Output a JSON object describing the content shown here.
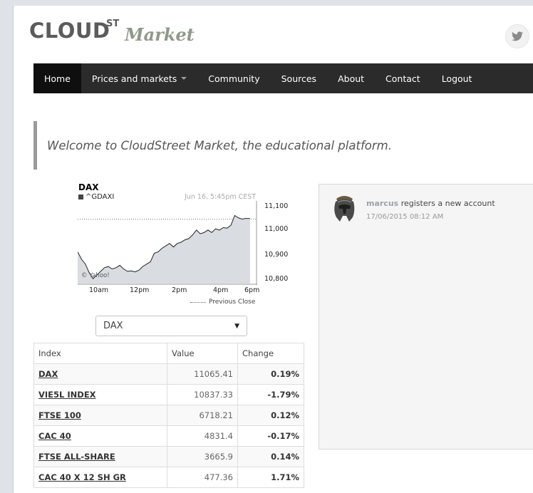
{
  "logo": {
    "cloud": "CLOUD",
    "st": "ST",
    "market": "Market"
  },
  "nav": {
    "items": [
      {
        "label": "Home",
        "active": true
      },
      {
        "label": "Prices and markets",
        "dropdown": true
      },
      {
        "label": "Community"
      },
      {
        "label": "Sources"
      },
      {
        "label": "About"
      },
      {
        "label": "Contact"
      },
      {
        "label": "Logout"
      }
    ]
  },
  "welcome": "Welcome to CloudStreet Market, the educational platform.",
  "chart": {
    "title": "DAX",
    "symbol": "^GDAXI",
    "date": "Jun 16, 5:45pm CEST",
    "copyright": "© Yahoo!",
    "previous_close_label": "Previous Close",
    "y_ticks": [
      "11,100",
      "11,000",
      "10,900",
      "10,800"
    ],
    "x_ticks": [
      "10am",
      "12pm",
      "2pm",
      "4pm",
      "6pm"
    ]
  },
  "chart_data": {
    "type": "line",
    "title": "DAX",
    "x_ticks": [
      "10am",
      "12pm",
      "2pm",
      "4pm",
      "6pm"
    ],
    "ylim": [
      10780,
      11120
    ],
    "previous_close": 11045,
    "series": [
      {
        "name": "^GDAXI",
        "x": [
          9.0,
          9.2,
          9.4,
          9.6,
          9.8,
          10.0,
          10.2,
          10.4,
          10.6,
          10.8,
          11.0,
          11.2,
          11.4,
          11.6,
          11.8,
          12.0,
          12.2,
          12.4,
          12.6,
          12.8,
          13.0,
          13.2,
          13.4,
          13.6,
          13.8,
          14.0,
          14.2,
          14.4,
          14.6,
          14.8,
          15.0,
          15.2,
          15.4,
          15.6,
          15.8,
          16.0,
          16.2,
          16.4,
          16.6,
          16.8,
          17.0,
          17.2,
          17.4,
          17.6,
          17.75,
          18.0
        ],
        "values": [
          10910,
          10880,
          10860,
          10825,
          10800,
          10815,
          10830,
          10845,
          10850,
          10840,
          10845,
          10855,
          10840,
          10830,
          10832,
          10828,
          10835,
          10850,
          10860,
          10870,
          10905,
          10910,
          10925,
          10935,
          10945,
          10930,
          10945,
          10950,
          10960,
          10965,
          10980,
          11000,
          10985,
          10990,
          11000,
          10990,
          11005,
          11000,
          11010,
          11008,
          11020,
          11060,
          11050,
          11045,
          11048,
          11048
        ]
      }
    ]
  },
  "select": {
    "value": "DAX"
  },
  "table": {
    "headers": [
      "Index",
      "Value",
      "Change"
    ],
    "rows": [
      {
        "index": "DAX",
        "value": "11065.41",
        "change": "0.19%"
      },
      {
        "index": "VIE5L INDEX",
        "value": "10837.33",
        "change": "-1.79%"
      },
      {
        "index": "FTSE 100",
        "value": "6718.21",
        "change": "0.12%"
      },
      {
        "index": "CAC 40",
        "value": "4831.4",
        "change": "-0.17%"
      },
      {
        "index": "FTSE ALL-SHARE",
        "value": "3665.9",
        "change": "0.14%"
      },
      {
        "index": "CAC 40 X 12 SH GR",
        "value": "477.36",
        "change": "1.71%"
      }
    ]
  },
  "activity": {
    "user": "marcus",
    "action": "registers a new account",
    "time": "17/06/2015 08:12 AM"
  }
}
